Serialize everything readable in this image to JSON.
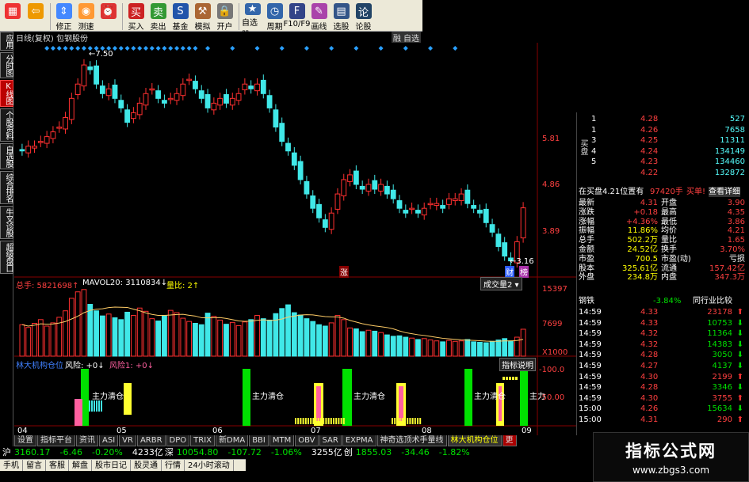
{
  "toolbar": {
    "buttons": [
      {
        "label": "",
        "icon": "grid-icon"
      },
      {
        "label": "",
        "icon": "back-arrow-icon"
      },
      {
        "label": "修正",
        "icon": "up-down-arrows-icon"
      },
      {
        "label": "测速",
        "icon": "speed-icon"
      },
      {
        "label": "",
        "icon": "alarm-clock-icon"
      },
      {
        "label": "买入",
        "icon": "buy-icon"
      },
      {
        "label": "卖出",
        "icon": "sell-icon"
      },
      {
        "label": "基金",
        "icon": "fund-icon"
      },
      {
        "label": "模拟",
        "icon": "hammer-icon"
      },
      {
        "label": "开户",
        "icon": "lock-icon"
      },
      {
        "label": "自选股",
        "icon": "watchlist-icon"
      },
      {
        "label": "周期",
        "icon": "period-icon"
      },
      {
        "label": "F10/F9",
        "icon": "f10-icon"
      },
      {
        "label": "画线",
        "icon": "pen-icon"
      },
      {
        "label": "选股",
        "icon": "select-stock-icon"
      },
      {
        "label": "论股",
        "icon": "discuss-icon"
      }
    ]
  },
  "sidebar": {
    "tabs": [
      "应用",
      "分时图",
      "K线图",
      "个股资料",
      "自选股",
      "综合排名",
      "牛叉诊股",
      "超级盘口"
    ]
  },
  "chart": {
    "title": "日线(复权) 包钢股份",
    "right_header": "融 自选",
    "price_labels": [
      "5.81",
      "4.86",
      "3.89"
    ],
    "high_label": "7.50",
    "low_label": "3.16",
    "marker_zhang": "涨",
    "marker_cai": "财",
    "marker_bang": "榜",
    "volume_header": {
      "total": "总手: 5821698↑",
      "mavol": "MAVOL20: 3110834↓",
      "ratio": "量比: 2↑",
      "dropdown": "成交量2"
    },
    "volume_labels": [
      "15397",
      "7699",
      "X1000"
    ],
    "indicator_header": {
      "name": "林大机构仓位",
      "risk": "风险: +0↓",
      "risk1": "风险1: +0↓",
      "help": "指标说明"
    },
    "indicator_labels": [
      "100.0",
      "50.00"
    ],
    "indicator_texts": [
      "主力清仓",
      "主力清仓",
      "主力清仓",
      "主力清仓",
      "主力"
    ],
    "date_labels": [
      "04",
      "05",
      "06",
      "07",
      "08",
      "09"
    ]
  },
  "quote": {
    "buy_label": "买盘",
    "bids": [
      {
        "n": "1",
        "p": "4.28",
        "v": "527"
      },
      {
        "n": "1",
        "p": "4.26",
        "v": "7658"
      },
      {
        "n": "3",
        "p": "4.25",
        "v": "11311"
      },
      {
        "n": "4",
        "p": "4.24",
        "v": "134149"
      },
      {
        "n": "5",
        "p": "4.23",
        "v": "134460"
      },
      {
        "n": "",
        "p": "4.22",
        "v": "132872"
      }
    ],
    "in_buy": "在买盘4.21位置有",
    "in_buy_amount": "97420手",
    "in_buy_action": "买单!",
    "detail": "查看详细",
    "stats": [
      {
        "k1": "最新",
        "v1": "4.31",
        "k2": "开盘",
        "v2": "3.90"
      },
      {
        "k1": "涨跌",
        "v1": "+0.18",
        "k2": "最高",
        "v2": "4.35"
      },
      {
        "k1": "涨幅",
        "v1": "+4.36%",
        "k2": "最低",
        "v2": "3.86"
      },
      {
        "k1": "振幅",
        "v1": "11.86%",
        "k2": "均价",
        "v2": "4.21"
      },
      {
        "k1": "总手",
        "v1": "502.2万",
        "k2": "量比",
        "v2": "1.65"
      },
      {
        "k1": "金额",
        "v1": "24.52亿",
        "k2": "换手",
        "v2": "3.70%"
      },
      {
        "k1": "市盈",
        "v1": "700.5",
        "k2": "市盈(动)",
        "v2": "亏损"
      },
      {
        "k1": "股本",
        "v1": "325.61亿",
        "k2": "流通",
        "v2": "157.42亿"
      },
      {
        "k1": "外盘",
        "v1": "234.8万",
        "k2": "内盘",
        "v2": "347.3万"
      }
    ],
    "sector_name": "钢铁",
    "sector_change": "-3.84%",
    "sector_compare": "同行业比较",
    "ticks": [
      {
        "t": "14:59",
        "p": "4.33",
        "v": "23178",
        "d": "up"
      },
      {
        "t": "14:59",
        "p": "4.33",
        "v": "10753",
        "d": "down"
      },
      {
        "t": "14:59",
        "p": "4.32",
        "v": "11364",
        "d": "down"
      },
      {
        "t": "14:59",
        "p": "4.32",
        "v": "14383",
        "d": "down"
      },
      {
        "t": "14:59",
        "p": "4.28",
        "v": "3050",
        "d": "down"
      },
      {
        "t": "14:59",
        "p": "4.27",
        "v": "4137",
        "d": "down"
      },
      {
        "t": "14:59",
        "p": "4.30",
        "v": "2199",
        "d": "up"
      },
      {
        "t": "14:59",
        "p": "4.28",
        "v": "3346",
        "d": "down"
      },
      {
        "t": "14:59",
        "p": "4.30",
        "v": "3755",
        "d": "up"
      },
      {
        "t": "15:00",
        "p": "4.26",
        "v": "15634",
        "d": "down"
      },
      {
        "t": "15:00",
        "p": "4.31",
        "v": "290",
        "d": "up"
      }
    ]
  },
  "bottom_tabs": [
    "设置",
    "指标平台",
    "资讯",
    "ASI",
    "VR",
    "ARBR",
    "DPO",
    "TRIX",
    "新DMA",
    "BBI",
    "MTM",
    "OBV",
    "SAR",
    "EXPMA",
    "神奇选顶术手量线",
    "林大机构仓位",
    "更"
  ],
  "status": {
    "sh": "沪",
    "sh_index": "3160.17",
    "sh_change": "-6.46",
    "sh_pct": "-0.20%",
    "sh_amount": "4233亿",
    "sz": "深",
    "sz_index": "10054.80",
    "sz_change": "-107.72",
    "sz_pct": "-1.06%",
    "sz_amount": "3255亿",
    "cy": "创",
    "cy_index": "1855.03",
    "cy_change": "-34.46",
    "cy_pct": "-1.82%"
  },
  "status_bar": [
    "手机",
    "留言",
    "客服",
    "解盘",
    "股市日记",
    "股灵通",
    "行情",
    "24小时滚动"
  ],
  "watermark": {
    "title": "指标公式网",
    "url": "www.zbgs3.com"
  },
  "colors": {
    "up": "#ff3030",
    "down": "#40e8e8",
    "ma": "#ffffff",
    "ind_green": "#00e000",
    "ind_yellow": "#ffff30",
    "ind_pink": "#ff60a0"
  },
  "chart_data": {
    "type": "bar",
    "title": "日线(复权) 包钢股份",
    "price_range": [
      3.16,
      7.5
    ],
    "candles_close": [
      5.5,
      5.6,
      5.6,
      5.7,
      5.8,
      5.9,
      6.0,
      6.2,
      6.6,
      6.9,
      7.3,
      7.2,
      6.9,
      6.7,
      6.8,
      6.6,
      6.4,
      6.1,
      6.3,
      6.5,
      6.7,
      6.8,
      6.6,
      6.5,
      6.6,
      6.7,
      6.9,
      7.0,
      6.8,
      6.6,
      6.4,
      6.5,
      6.6,
      6.5,
      6.6,
      6.7,
      6.9,
      6.8,
      6.9,
      6.7,
      6.4,
      6.0,
      5.7,
      5.5,
      5.2,
      4.9,
      4.6,
      4.3,
      4.1,
      3.9,
      4.2,
      4.6,
      4.9,
      5.0,
      4.8,
      4.7,
      4.8,
      4.7,
      4.8,
      4.6,
      4.5,
      4.3,
      4.2,
      4.3,
      4.2,
      4.3,
      4.4,
      4.4,
      4.3,
      4.5,
      4.5,
      4.6,
      4.4,
      4.3,
      4.2,
      4.0,
      3.8,
      3.5,
      3.3,
      3.2,
      3.6,
      4.31
    ],
    "volumes": [
      6800,
      6200,
      7100,
      7900,
      6500,
      7200,
      8400,
      9800,
      12500,
      13900,
      14400,
      11200,
      9800,
      8700,
      9100,
      8300,
      7900,
      9500,
      8800,
      10400,
      9700,
      8100,
      7600,
      8800,
      9900,
      9400,
      8200,
      7500,
      7100,
      6800,
      9300,
      8600,
      7800,
      6900,
      7300,
      6600,
      7400,
      7900,
      8800,
      8100,
      7800,
      9200,
      10300,
      11100,
      9400,
      8900,
      8100,
      7500,
      6800,
      6500,
      7200,
      8800,
      7900,
      6100,
      5900,
      5300,
      5600,
      5400,
      5100,
      4600,
      4300,
      4400,
      4100,
      3900,
      3600,
      3800,
      3500,
      3300,
      3100,
      3400,
      3200,
      3300,
      3600,
      3100,
      3000,
      2900,
      3200,
      3500,
      3800,
      3300,
      4100,
      5821
    ]
  }
}
